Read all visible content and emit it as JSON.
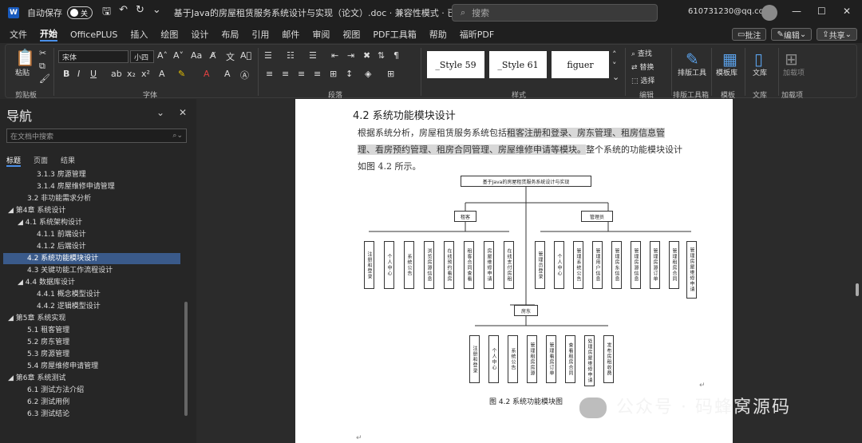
{
  "titlebar": {
    "autosave_label": "自动保存",
    "autosave_state": "关",
    "doc_title": "基于Java的房屋租赁服务系统设计与实现（论文）.doc · 兼容性模式 · 已保存 ⌄",
    "search_placeholder": "搜索",
    "account": "610731230@qq.com"
  },
  "tabs": [
    "文件",
    "开始",
    "OfficePLUS",
    "插入",
    "绘图",
    "设计",
    "布局",
    "引用",
    "邮件",
    "审阅",
    "视图",
    "PDF工具箱",
    "帮助",
    "福昕PDF"
  ],
  "tab_buttons": {
    "comment": "批注",
    "edit": "编辑",
    "share": "共享"
  },
  "ribbon": {
    "font_name": "宋体",
    "font_size": "小四",
    "paste_label": "粘贴",
    "groups": [
      "剪贴板",
      "字体",
      "段落",
      "样式",
      "编辑",
      "排版工具箱",
      "模板",
      "文库",
      "加载项"
    ],
    "styles": [
      "_Style 59",
      "_Style 61",
      "figuer"
    ],
    "edit_items": [
      "查找",
      "替换",
      "选择"
    ],
    "big_buttons": [
      "排版工具",
      "模板库",
      "文库",
      "加载项"
    ]
  },
  "nav": {
    "title": "导航",
    "search_placeholder": "在文档中搜索",
    "tabs": [
      "标题",
      "页面",
      "结果"
    ],
    "items": [
      {
        "text": "3.1.3  房源管理",
        "level": 3
      },
      {
        "text": "3.1.4  房屋维修申请管理",
        "level": 3
      },
      {
        "text": "3.2  非功能需求分析",
        "level": 2
      },
      {
        "text": "◢ 第4章  系统设计",
        "level": 1
      },
      {
        "text": "◢ 4.1  系统架构设计",
        "level": 2
      },
      {
        "text": "4.1.1  前端设计",
        "level": 3
      },
      {
        "text": "4.1.2  后端设计",
        "level": 3
      },
      {
        "text": "4.2  系统功能模块设计",
        "level": 2,
        "selected": true
      },
      {
        "text": "4.3  关键功能工作流程设计",
        "level": 2
      },
      {
        "text": "◢ 4.4  数据库设计",
        "level": 2
      },
      {
        "text": "4.4.1  概念模型设计",
        "level": 3
      },
      {
        "text": "4.4.2  逻辑模型设计",
        "level": 3
      },
      {
        "text": "◢ 第5章  系统实现",
        "level": 1
      },
      {
        "text": "5.1  租客管理",
        "level": 2
      },
      {
        "text": "5.2  房东管理",
        "level": 2
      },
      {
        "text": "5.3  房源管理",
        "level": 2
      },
      {
        "text": "5.4  房屋维修申请管理",
        "level": 2
      },
      {
        "text": "◢ 第6章  系统测试",
        "level": 1
      },
      {
        "text": "6.1  测试方法介绍",
        "level": 2
      },
      {
        "text": "6.2  测试用例",
        "level": 2
      },
      {
        "text": "6.3  测试结论",
        "level": 2
      }
    ]
  },
  "doc": {
    "heading": "4.2    系统功能模块设计",
    "para_line1_a": "根据系统分析，房屋租赁服务系统包括",
    "para_line1_b": "租客注册和登录、房东管理、租房信息管",
    "para_line2_a": "理、看房预约管理、租房合同管理、房屋维修申请等模块。",
    "para_line2_b": "整个系统的功能模块设计",
    "para_line3": "如图 4.2 所示。",
    "caption": "图 4.2  系统功能模块图",
    "diagram": {
      "root": "基于Java的房屋租赁服务系统设计与实现",
      "tenant": "租客",
      "admin": "管理员",
      "landlord": "房东",
      "tenant_children": [
        "注册和登录",
        "个人中心",
        "系统公告",
        "浏览房源信息",
        "在线预约看房",
        "租客合同查看",
        "房屋维修申请",
        "在线支付房租"
      ],
      "admin_children": [
        "管理员登录",
        "个人中心",
        "管理系统公告",
        "管理用户信息",
        "管理房东信息",
        "管理房源信息",
        "管理房源订单",
        "管理租房合同",
        "管理房屋维修申请"
      ],
      "landlord_children": [
        "注册和登录",
        "个人中心",
        "系统公告",
        "管理租房房源",
        "管理看房订单",
        "查看租房合同",
        "处理房屋维修申请",
        "发布房租收费"
      ]
    }
  },
  "watermark": "公众号 · 码蜂窝源码"
}
